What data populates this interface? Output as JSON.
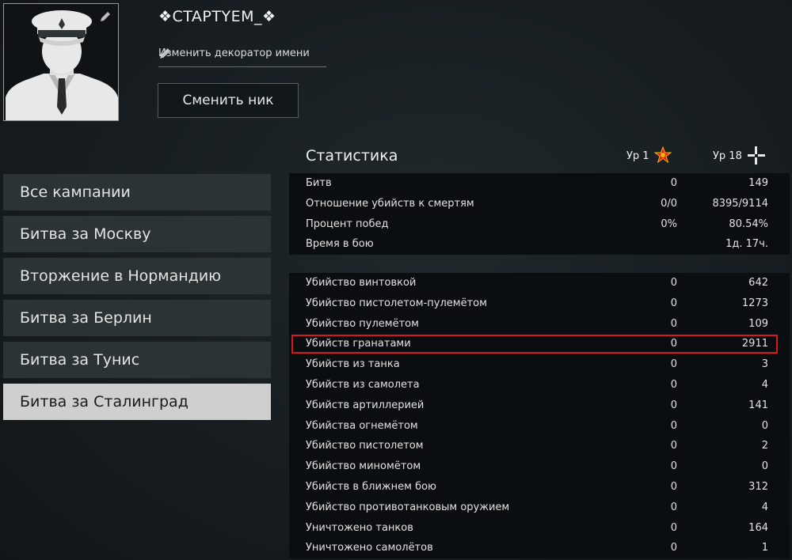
{
  "profile": {
    "name": "❖CTAPTYEM_❖",
    "decorator_label": "Изменить декоратор имени",
    "rename_button": "Сменить ник"
  },
  "campaigns": [
    {
      "label": "Все кампании",
      "active": false
    },
    {
      "label": "Битва за Москву",
      "active": false
    },
    {
      "label": "Вторжение в Нормандию",
      "active": false
    },
    {
      "label": "Битва за Берлин",
      "active": false
    },
    {
      "label": "Битва за Тунис",
      "active": false
    },
    {
      "label": "Битва за Сталинград",
      "active": true
    }
  ],
  "stats": {
    "title": "Статистика",
    "level1_label": "Ур 1",
    "level2_label": "Ур 18",
    "star_color": "#e02020",
    "highlight_color": "#d8191c",
    "summary": [
      {
        "label": "Битв",
        "v1": "0",
        "v2": "149"
      },
      {
        "label": "Отношение убийств к смертям",
        "v1": "0/0",
        "v2": "8395/9114"
      },
      {
        "label": "Процент побед",
        "v1": "0%",
        "v2": "80.54%"
      },
      {
        "label": "Время в бою",
        "v1": "",
        "v2": "1д. 17ч."
      }
    ],
    "details": [
      {
        "label": "Убийство винтовкой",
        "v1": "0",
        "v2": "642"
      },
      {
        "label": "Убийство пистолетом-пулемётом",
        "v1": "0",
        "v2": "1273"
      },
      {
        "label": "Убийство пулемётом",
        "v1": "0",
        "v2": "109"
      },
      {
        "label": "Убийств гранатами",
        "v1": "0",
        "v2": "2911",
        "highlight": true
      },
      {
        "label": "Убийств из танка",
        "v1": "0",
        "v2": "3"
      },
      {
        "label": "Убийств из самолета",
        "v1": "0",
        "v2": "4"
      },
      {
        "label": "Убийств артиллерией",
        "v1": "0",
        "v2": "141"
      },
      {
        "label": "Убийства огнемётом",
        "v1": "0",
        "v2": "0"
      },
      {
        "label": "Убийство пистолетом",
        "v1": "0",
        "v2": "2"
      },
      {
        "label": "Убийство миномётом",
        "v1": "0",
        "v2": "0"
      },
      {
        "label": "Убийств в ближнем бою",
        "v1": "0",
        "v2": "312"
      },
      {
        "label": "Убийство противотанковым оружием",
        "v1": "0",
        "v2": "4"
      },
      {
        "label": "Уничтожено танков",
        "v1": "0",
        "v2": "164"
      },
      {
        "label": "Уничтожено самолётов",
        "v1": "0",
        "v2": "1"
      }
    ]
  }
}
